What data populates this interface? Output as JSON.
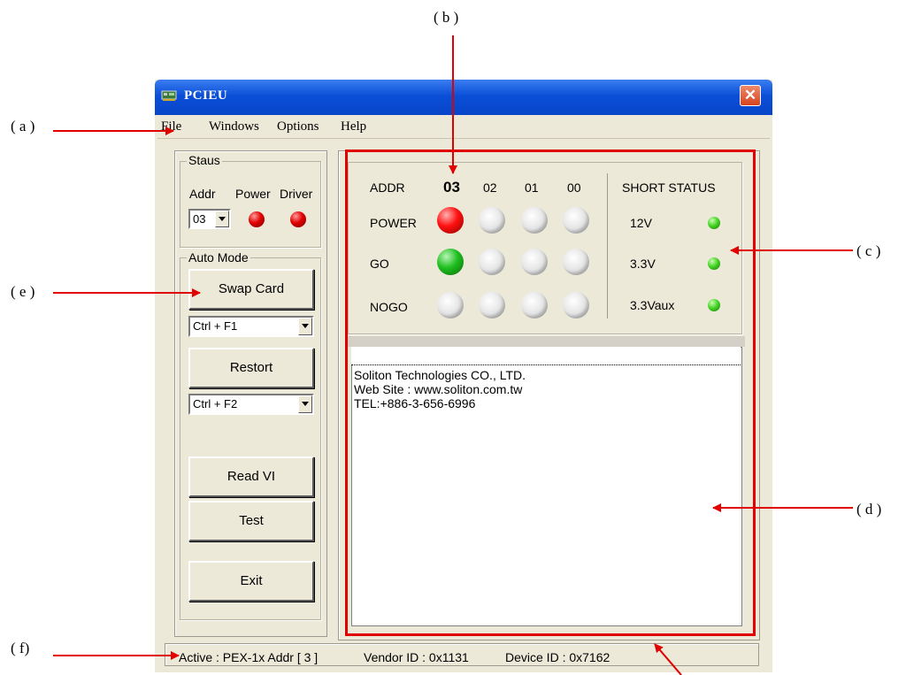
{
  "window": {
    "title": "PCIEU",
    "close_glyph": "✕",
    "app_icon": "app-card-icon"
  },
  "menu": [
    "File",
    "Windows",
    "Options",
    "Help"
  ],
  "status_group": {
    "label": "Staus",
    "addr_label": "Addr",
    "power_label": "Power",
    "driver_label": "Driver",
    "addr_value": "03"
  },
  "auto_mode": {
    "label": "Auto Mode",
    "swap_card": "Swap Card",
    "hotkey1": "Ctrl + F1",
    "restort": "Restort",
    "hotkey2": "Ctrl + F2",
    "read_vi": "Read VI",
    "test": "Test",
    "exit": "Exit"
  },
  "panel": {
    "addr_label": "ADDR",
    "addresses": [
      "03",
      "02",
      "01",
      "00"
    ],
    "rows": [
      "POWER",
      "GO",
      "NOGO"
    ],
    "short_status_label": "SHORT STATUS",
    "voltages": [
      "12V",
      "3.3V",
      "3.3Vaux"
    ]
  },
  "log": [
    "Soliton Technologies CO., LTD.",
    "Web Site : www.soliton.com.tw",
    "TEL:+886-3-656-6996"
  ],
  "statusbar": {
    "active": "Active :  PEX-1x Addr [ 3 ]",
    "vendor": "Vendor ID : 0x1131",
    "device": "Device ID : 0x7162"
  },
  "callouts": {
    "a": "( a )",
    "b": "( b )",
    "c": "( c )",
    "d": "( d )",
    "e": "( e )",
    "f": "( f)"
  },
  "colors": {
    "annotation": "#e00000",
    "titlebar": "#0a4fd8",
    "window_bg": "#ece9d8"
  }
}
